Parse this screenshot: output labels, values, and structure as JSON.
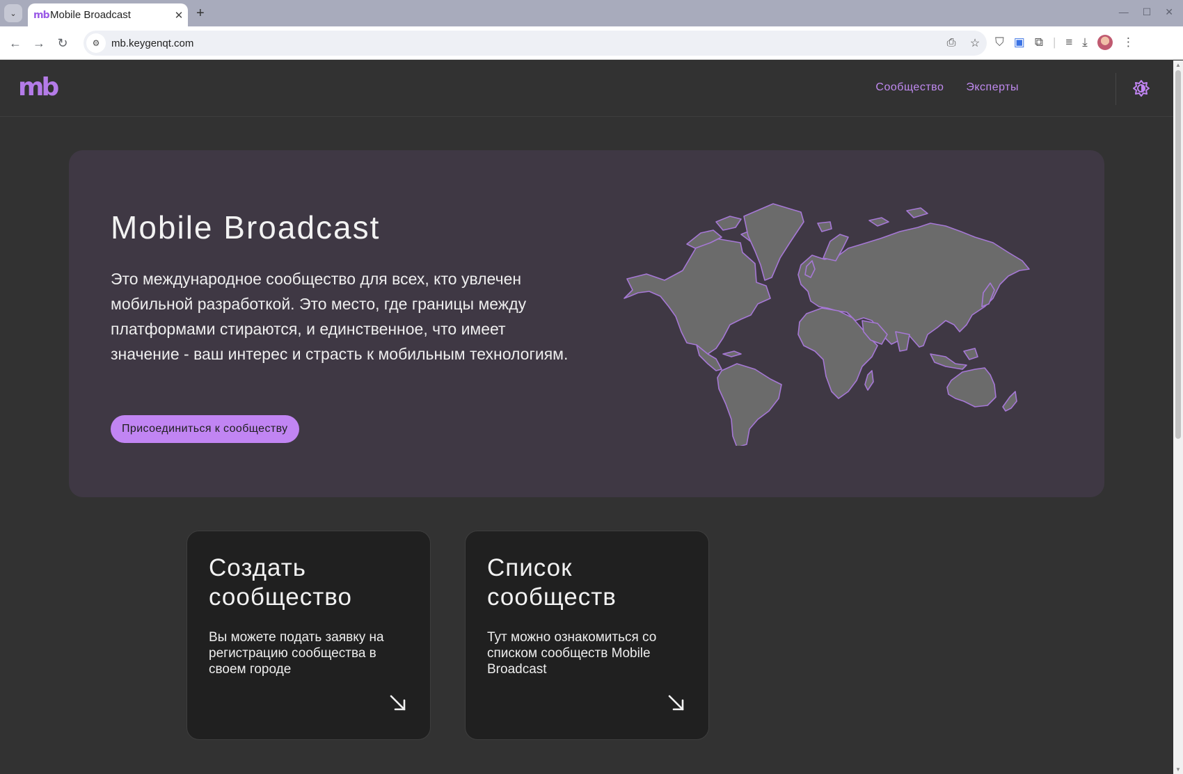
{
  "browser": {
    "tab_title": "Mobile Broadcast",
    "tab_favicon": "mb",
    "url": "mb.keygenqt.com"
  },
  "site": {
    "logo": "mb",
    "nav": [
      {
        "label": "Сообщество"
      },
      {
        "label": "Эксперты"
      }
    ],
    "theme_icon": "theme-toggle-icon",
    "accent_color": "#c185f3"
  },
  "hero": {
    "title": "Mobile Broadcast",
    "text": "Это международное сообщество для всех, кто увлечен мобильной разработкой. Это место, где границы между платформами стираются, и единственное, что имеет значение - ваш интерес и страсть к мобильным технологиям.",
    "button_label": "Присоединиться к сообществу"
  },
  "cards": [
    {
      "title": "Создать сообщество",
      "text": "Вы можете подать заявку на регистрацию сообщества в своем городе"
    },
    {
      "title": "Список сообществ",
      "text": "Тут можно ознакомиться со списком сообществ Mobile Broadcast"
    }
  ]
}
